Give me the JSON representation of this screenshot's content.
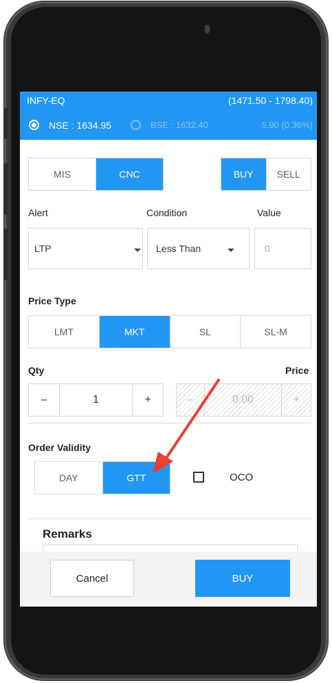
{
  "header": {
    "symbol": "INFY-EQ",
    "range": "(1471.50 - 1798.40)",
    "nse_label": "NSE : 1634.95",
    "bse_label": "BSE : 1632.40",
    "change": "5.90 (0.36%)"
  },
  "product": {
    "options": [
      "MIS",
      "CNC"
    ],
    "selected": "CNC"
  },
  "side": {
    "options": [
      "BUY",
      "SELL"
    ],
    "selected": "BUY"
  },
  "alert": {
    "labels": {
      "alert": "Alert",
      "condition": "Condition",
      "value": "Value"
    },
    "alert_value": "LTP",
    "condition_value": "Less Than",
    "value_placeholder": "0"
  },
  "price_type": {
    "label": "Price Type",
    "options": [
      "LMT",
      "MKT",
      "SL",
      "SL-M"
    ],
    "selected": "MKT"
  },
  "qty": {
    "label": "Qty",
    "minus": "–",
    "value": "1",
    "plus": "+"
  },
  "price": {
    "label": "Price",
    "minus": "–",
    "value": "0.00",
    "plus": "+"
  },
  "validity": {
    "label": "Order Validity",
    "options": [
      "DAY",
      "GTT"
    ],
    "selected": "GTT",
    "oco_label": "OCO"
  },
  "remarks": {
    "label": "Remarks"
  },
  "footer": {
    "cancel": "Cancel",
    "buy": "BUY"
  },
  "colors": {
    "accent": "#2196f3",
    "arrow": "#e8412e"
  }
}
